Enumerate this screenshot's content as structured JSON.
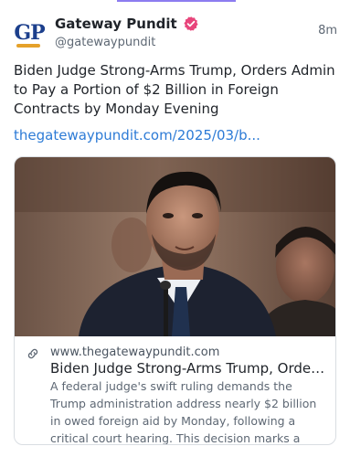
{
  "post": {
    "author": {
      "display_name": "Gateway Pundit",
      "handle": "@gatewaypundit",
      "avatar_text": "GP",
      "verified": true
    },
    "timestamp": "8m",
    "text": "Biden Judge Strong-Arms Trump, Orders Admin to Pay a Portion of $2 Billion in Foreign Contracts by Monday Evening",
    "link_text": "thegatewaypundit.com/2025/03/b..."
  },
  "link_card": {
    "domain": "www.thegatewaypundit.com",
    "title": "Biden Judge Strong-Arms Trump, Orders Admi...",
    "description": "A federal judge's swift ruling demands the Trump administration address nearly $2 billion in owed foreign aid by Monday, following a critical court hearing. This decision marks a significant moment in ongoing legal ..."
  },
  "colors": {
    "link": "#2d7bd6",
    "verified_badge": "#e8457b",
    "avatar_brand": "#1c3f8c",
    "tab_indicator": "#8c7cf0"
  },
  "icons": {
    "verified": "verified-badge-icon",
    "link": "link-chain-icon"
  }
}
